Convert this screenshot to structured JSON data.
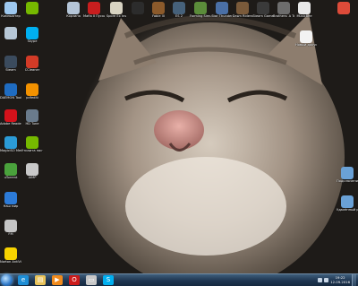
{
  "left_icons": [
    {
      "label": "Компьютер",
      "icon": "computer-icon",
      "color": "#9ec8ef"
    },
    {
      "label": "",
      "icon": "nvidia-icon",
      "color": "#76b900"
    },
    {
      "label": "",
      "icon": "recycle-bin-icon",
      "color": "#b7c7d6"
    },
    {
      "label": "Skype",
      "icon": "skype-icon",
      "color": "#00aff0"
    },
    {
      "label": "Steam",
      "icon": "steam-icon",
      "color": "#3b4b5d"
    },
    {
      "label": "CCleaner",
      "icon": "ccleaner-icon",
      "color": "#d33b27"
    },
    {
      "label": "DAEMON Tools Lite",
      "icon": "daemon-tools-icon",
      "color": "#1f6cc1"
    },
    {
      "label": "pdfediti",
      "icon": "pdf-editor-icon",
      "color": "#f39200"
    },
    {
      "label": "Adobe Reader XI",
      "icon": "adobe-reader-icon",
      "color": "#d4121b"
    },
    {
      "label": "HD Tune",
      "icon": "hdtune-icon",
      "color": "#6a7b8c"
    },
    {
      "label": "MagicISO Mediabox",
      "icon": "magiciso-icon",
      "color": "#2b9bd6"
    },
    {
      "label": "Утилита настройки",
      "icon": "nvidia-settings-icon",
      "color": "#76b900"
    },
    {
      "label": "uTorrent",
      "icon": "utorrent-icon",
      "color": "#4aa23c"
    },
    {
      "label": "AIMP",
      "icon": "aimp-icon",
      "color": "#c9c9c9"
    },
    {
      "label": "Наш мир",
      "icon": "social-icon",
      "color": "#2c7bd8"
    },
    {
      "label": "FM",
      "icon": "folder-manager-icon",
      "color": "#c5c5c5"
    },
    {
      "label": "Norton AntiVirus",
      "icon": "norton-icon",
      "color": "#f7d300"
    }
  ],
  "top_icons": [
    {
      "label": "Корзина",
      "icon": "recycle-bin-icon",
      "color": "#b5c6d8"
    },
    {
      "label": "Mafia II Пуски",
      "icon": "mafia-icon",
      "color": "#c91e1e"
    },
    {
      "label": "Spore Ex Ins",
      "icon": "spore-icon",
      "color": "#d8d3c2"
    },
    {
      "label": "",
      "icon": "game-icon",
      "color": "#2c2c2c"
    },
    {
      "label": "Fable III",
      "icon": "fable-icon",
      "color": "#8b5a2b"
    },
    {
      "label": "ES 2",
      "icon": "es-icon",
      "color": "#46617a"
    },
    {
      "label": "Farming Simulator",
      "icon": "farming-sim-icon",
      "color": "#5b8c3a"
    },
    {
      "label": "Star Thunder",
      "icon": "star-thunder-icon",
      "color": "#4a6fa5"
    },
    {
      "label": "Dawn Riders",
      "icon": "dawn-riders-icon",
      "color": "#7a5a3a"
    },
    {
      "label": "Steam Game",
      "icon": "steam-game-icon",
      "color": "#3a3a3a"
    },
    {
      "label": "Brothers: A Tale of Two Sons",
      "icon": "brothers-icon",
      "color": "#6d6d6d"
    },
    {
      "label": "MusicBee",
      "icon": "musicbee-icon",
      "color": "#e8e8e8"
    },
    {
      "label": "",
      "icon": "google-chrome-icon",
      "color": "#dd4b39"
    }
  ],
  "right_icons": [
    {
      "label": "Новый документ",
      "icon": "document-icon",
      "color": "#f2f2f2"
    },
    {
      "label": "Подключение к сети",
      "icon": "network-icon",
      "color": "#6aa1d6"
    },
    {
      "label": "Удалённый рабочий стол",
      "icon": "remote-desktop-icon",
      "color": "#6aa1d6"
    }
  ],
  "taskbar": {
    "pinned": [
      {
        "icon": "internet-explorer-icon",
        "color": "#1e8ed6",
        "glyph": "e"
      },
      {
        "icon": "explorer-folder-icon",
        "color": "#e8c35b",
        "glyph": "▤"
      },
      {
        "icon": "media-player-icon",
        "color": "#f08a1c",
        "glyph": "▶"
      },
      {
        "icon": "opera-icon",
        "color": "#cc1b1b",
        "glyph": "O"
      },
      {
        "icon": "files-icon",
        "color": "#c8c8c8",
        "glyph": "▭"
      },
      {
        "icon": "skype-taskbar-icon",
        "color": "#00aff0",
        "glyph": "S"
      }
    ],
    "clock_time": "19:22",
    "clock_date": "12.09.2016"
  }
}
